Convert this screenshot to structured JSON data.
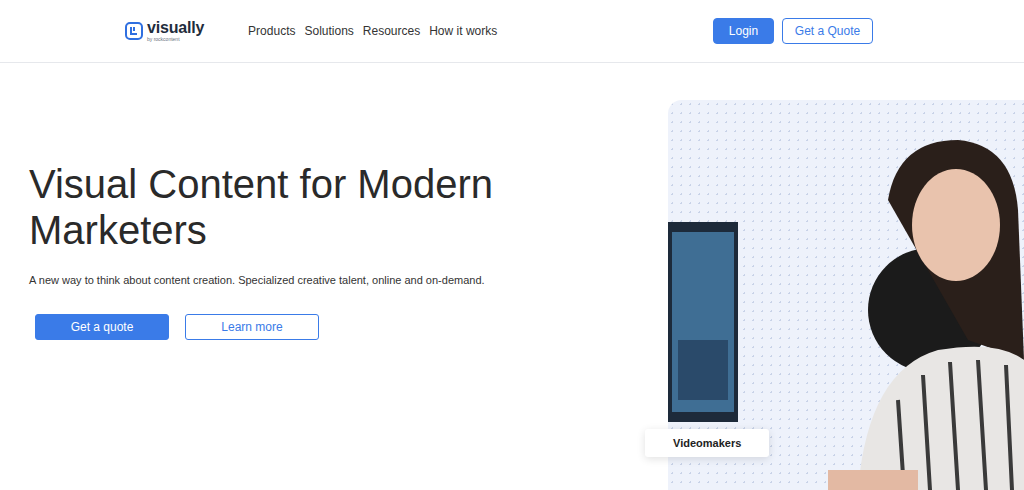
{
  "logo": {
    "name": "visually",
    "tagline": "by rockcontent"
  },
  "nav": [
    "Products",
    "Solutions",
    "Resources",
    "How it works"
  ],
  "header_buttons": [
    {
      "label": "Login",
      "kind": "primary"
    },
    {
      "label": "Get a Quote",
      "kind": "outline"
    }
  ],
  "hero": {
    "title": "Visual Content for Modern Marketers",
    "subtitle": "A new way to think about content creation. Specialized creative talent, online and on-demand.",
    "buttons": [
      {
        "label": "Get a quote",
        "kind": "primary"
      },
      {
        "label": "Learn more",
        "kind": "outline"
      }
    ]
  },
  "showcase": {
    "badge": "Videomakers"
  }
}
